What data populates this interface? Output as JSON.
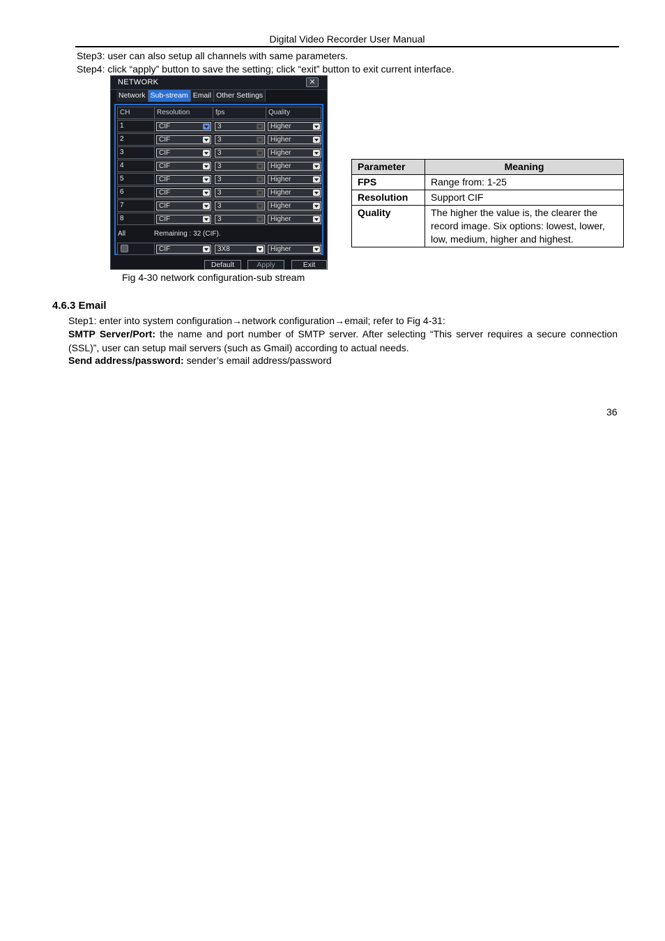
{
  "page": {
    "header_title": "Digital Video Recorder User Manual",
    "step3": "Step3: user can also setup all channels with same parameters.",
    "step4": "Step4: click “apply” button to save the setting; click “exit” button to exit current interface.",
    "figure_caption": "Fig 4-30 network configuration-sub stream",
    "section_heading": "4.6.3  Email",
    "email_step1": "Step1: enter into system configuration→network configuration→email; refer to Fig 4-31:",
    "smtp_label": "SMTP Server/Port:",
    "smtp_text": " the name and port number of SMTP server. After selecting “This server requires a secure connection (SSL)”, user can setup mail servers (such as Gmail) according to actual needs.",
    "send_label": "Send address/password:",
    "send_text": " sender’s email address/password",
    "page_number": "36"
  },
  "dialog": {
    "title": "NETWORK",
    "close_icon": "close-icon",
    "tabs": [
      {
        "label": "Network",
        "active": false
      },
      {
        "label": "Sub-stream",
        "active": true
      },
      {
        "label": "Email",
        "active": false
      },
      {
        "label": "Other Settings",
        "active": false
      }
    ],
    "columns": [
      "CH",
      "Resolution",
      "fps",
      "Quality"
    ],
    "rows": [
      {
        "ch": "1",
        "resolution": "CIF",
        "fps": "3",
        "quality": "Higher"
      },
      {
        "ch": "2",
        "resolution": "CIF",
        "fps": "3",
        "quality": "Higher"
      },
      {
        "ch": "3",
        "resolution": "CIF",
        "fps": "3",
        "quality": "Higher"
      },
      {
        "ch": "4",
        "resolution": "CIF",
        "fps": "3",
        "quality": "Higher"
      },
      {
        "ch": "5",
        "resolution": "CIF",
        "fps": "3",
        "quality": "Higher"
      },
      {
        "ch": "6",
        "resolution": "CIF",
        "fps": "3",
        "quality": "Higher"
      },
      {
        "ch": "7",
        "resolution": "CIF",
        "fps": "3",
        "quality": "Higher"
      },
      {
        "ch": "8",
        "resolution": "CIF",
        "fps": "3",
        "quality": "Higher"
      }
    ],
    "all_label": "All",
    "remaining": "Remaining : 32 (CIF).",
    "all_row": {
      "checked": false,
      "resolution": "CIF",
      "fps": "3X8",
      "quality": "Higher"
    },
    "buttons": {
      "default": "Default",
      "apply": "Apply",
      "exit": "Exit"
    },
    "colors": {
      "accent": "#2a6fd0",
      "background": "#14161c"
    }
  },
  "param_table": {
    "headers": [
      "Parameter",
      "Meaning"
    ],
    "rows": [
      {
        "parameter": "FPS",
        "meaning": "Range from: 1-25"
      },
      {
        "parameter": "Resolution",
        "meaning": "Support CIF"
      },
      {
        "parameter": "Quality",
        "meaning": "The higher the value is, the clearer the record image. Six options: lowest, lower, low, medium, higher and highest."
      }
    ]
  }
}
